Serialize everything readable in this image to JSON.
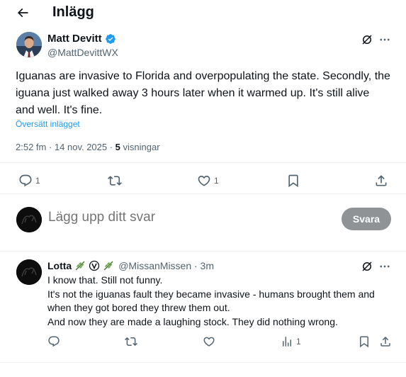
{
  "header": {
    "title": "Inlägg",
    "back_icon": "arrow-left-icon"
  },
  "post": {
    "author_name": "Matt Devitt",
    "author_handle": "@MattDevittWX",
    "verified": true,
    "text": "Iguanas are invasive to Florida and overpopulating the state. Secondly, the iguana just walked away 3 hours later when it warmed up. It's still alive and well. It's fine.",
    "translate_label": "Översätt inlägget",
    "timestamp": "2:52 fm · 14 nov. 2025 · ",
    "views_count": "5",
    "views_label": " visningar",
    "actions": {
      "reply_count": "1",
      "repost_count": "",
      "like_count": "1"
    }
  },
  "composer": {
    "placeholder": "Lägg upp ditt svar",
    "button_label": "Svara"
  },
  "reply": {
    "author_name": "Lotta",
    "handle_time": "@MissanMissen · 3m",
    "lines": [
      "I know that.  Still not funny.",
      "It's not the iguanas fault they became invasive - humans brought them and when they got bored they threw them out.",
      "And now they are made a laughing stock. They did nothing wrong."
    ],
    "actions": {
      "views_count": "1"
    }
  },
  "colors": {
    "accent": "#1d9bf0",
    "text": "#0f1419",
    "secondary": "#536471",
    "button_disabled": "#8f9396",
    "divider": "#eff3f4"
  }
}
